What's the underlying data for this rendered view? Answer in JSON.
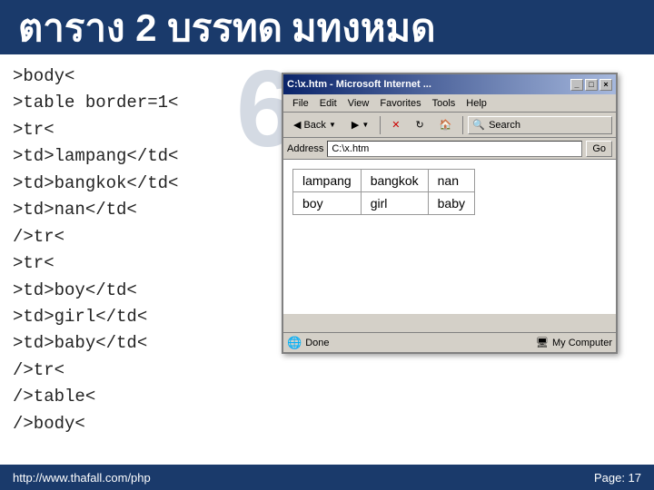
{
  "header": {
    "title": "ตาราง 2 บรรทด",
    "subtitle": "มทงหมด"
  },
  "big_number": "6",
  "code": {
    "lines": [
      ">body<",
      ">table border=1<",
      ">tr<",
      ">td>lampang</td<",
      ">td>bangkok</td<",
      ">td>nan</td<",
      "/>tr<",
      ">tr<",
      ">td>boy</td<",
      ">td>girl</td<",
      ">td>baby</td<",
      "/>tr<",
      "/>table<",
      "/>body<"
    ]
  },
  "browser": {
    "titlebar": "C:\\x.htm - Microsoft Internet ...",
    "menu": [
      "File",
      "Edit",
      "View",
      "Favorites",
      "Tools",
      "Help"
    ],
    "toolbar": {
      "back": "Back",
      "forward": "",
      "stop": "",
      "refresh": "",
      "home": "",
      "search": "Search",
      "favorites": "",
      "history": ""
    },
    "address_label": "Address",
    "address_value": "C:\\x.htm",
    "go_label": "Go",
    "table": {
      "rows": [
        [
          "lampang",
          "bangkok",
          "nan"
        ],
        [
          "boy",
          "girl",
          "baby"
        ]
      ]
    },
    "status": {
      "left": "Done",
      "right": "My Computer"
    }
  },
  "footer": {
    "url": "http://www.thafall.com/php",
    "page": "Page: 17"
  }
}
